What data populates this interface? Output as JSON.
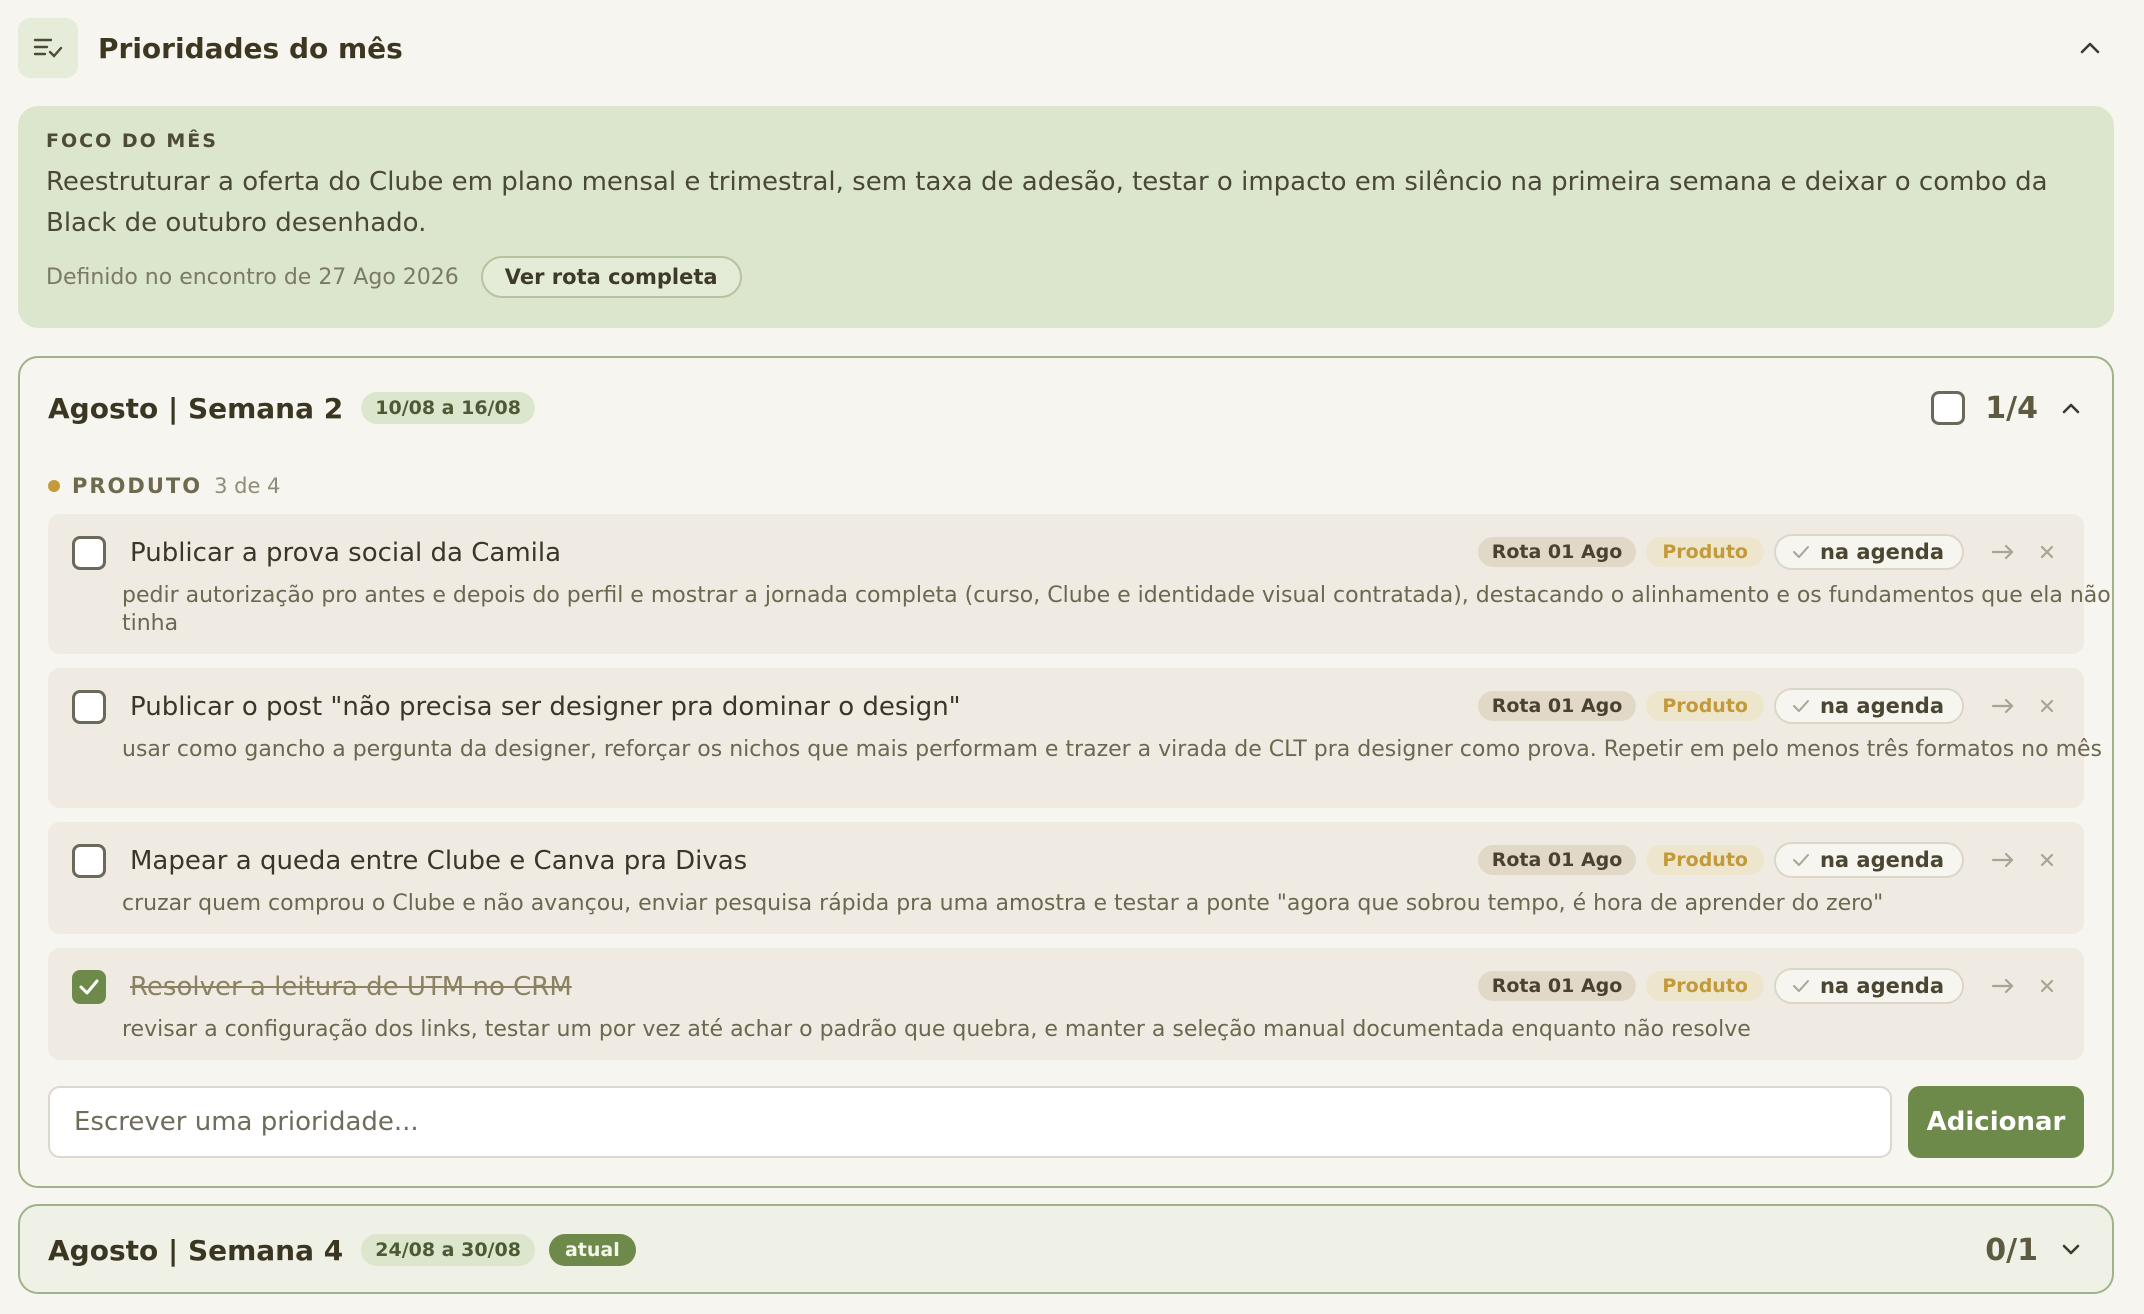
{
  "header": {
    "title": "Prioridades do mês",
    "icon": "list-check-icon"
  },
  "focus": {
    "label": "FOCO DO MÊS",
    "text": "Reestruturar a oferta do Clube em plano mensal e trimestral, sem taxa de adesão, testar o impacto em silêncio na primeira semana e deixar o combo da Black de outubro desenhado.",
    "date": "Definido no encontro de 27 Ago 2026",
    "link_label": "Ver rota completa"
  },
  "week1": {
    "title": "Agosto | Semana 2",
    "range": "10/08 a 16/08",
    "count": "1/4",
    "category": {
      "name": "PRODUTO",
      "count": "3 de 4",
      "color": "#c69a3c"
    },
    "tasks": [
      {
        "title": "Publicar a prova social da Camila",
        "desc": "pedir autorização pro antes e depois do perfil e mostrar a jornada completa (curso, Clube e identidade visual contratada), destacando o alinhamento e os fundamentos que ela não tinha",
        "rota": "Rota 01 Ago",
        "cat": "Produto",
        "agenda": "na agenda",
        "done": false
      },
      {
        "title": "Publicar o post \"não precisa ser designer pra dominar o design\"",
        "desc": "usar como gancho a pergunta da designer, reforçar os nichos que mais performam e trazer a virada de CLT pra designer como prova. Repetir em pelo menos três formatos no mês",
        "rota": "Rota 01 Ago",
        "cat": "Produto",
        "agenda": "na agenda",
        "done": false
      },
      {
        "title": "Mapear a queda entre Clube e Canva pra Divas",
        "desc": "cruzar quem comprou o Clube e não avançou, enviar pesquisa rápida pra uma amostra e testar a ponte \"agora que sobrou tempo, é hora de aprender do zero\"",
        "rota": "Rota 01 Ago",
        "cat": "Produto",
        "agenda": "na agenda",
        "done": false
      },
      {
        "title": "Resolver a leitura de UTM no CRM",
        "desc": "revisar a configuração dos links, testar um por vez até achar o padrão que quebra, e manter a seleção manual documentada enquanto não resolve",
        "rota": "Rota 01 Ago",
        "cat": "Produto",
        "agenda": "na agenda",
        "done": true
      }
    ],
    "add_placeholder": "Escrever uma prioridade...",
    "add_label": "Adicionar"
  },
  "week2": {
    "title": "Agosto | Semana 4",
    "range": "24/08 a 30/08",
    "current_label": "atual",
    "count": "0/1"
  },
  "colors": {
    "accent": "#6e8a4b",
    "focus_bg": "#dce6cc",
    "border": "#9fb389"
  }
}
